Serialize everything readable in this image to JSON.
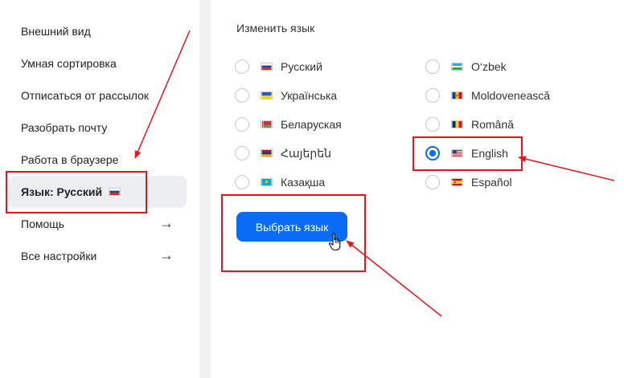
{
  "sidebar": {
    "items": [
      {
        "label": "Внешний вид"
      },
      {
        "label": "Умная сортировка"
      },
      {
        "label": "Отписаться от рассылок"
      },
      {
        "label": "Разобрать почту"
      },
      {
        "label": "Работа в браузере"
      },
      {
        "label": "Язык: Русский",
        "active": true
      },
      {
        "label": "Помощь",
        "arrow": "→"
      },
      {
        "label": "Все настройки",
        "arrow": "→"
      }
    ]
  },
  "main": {
    "title": "Изменить язык",
    "languages": [
      {
        "label": "Русский",
        "flag": "ru",
        "checked": false
      },
      {
        "label": "Українська",
        "flag": "ua",
        "checked": false
      },
      {
        "label": "Беларуская",
        "flag": "by",
        "checked": false
      },
      {
        "label": "Հայերեն",
        "flag": "am",
        "checked": false
      },
      {
        "label": "Казақша",
        "flag": "kz",
        "checked": false
      },
      {
        "label": "O‘zbek",
        "flag": "uz",
        "checked": false
      },
      {
        "label": "Moldovenească",
        "flag": "md",
        "checked": false
      },
      {
        "label": "Română",
        "flag": "ro",
        "checked": false
      },
      {
        "label": "English",
        "flag": "us",
        "checked": true
      },
      {
        "label": "Español",
        "flag": "es",
        "checked": false
      }
    ],
    "submit_label": "Выбрать язык"
  },
  "colors": {
    "accent": "#0a6cf5",
    "radio_checked": "#0070f0",
    "annotation": "#e8141b",
    "active_bg": "#edeef2"
  }
}
